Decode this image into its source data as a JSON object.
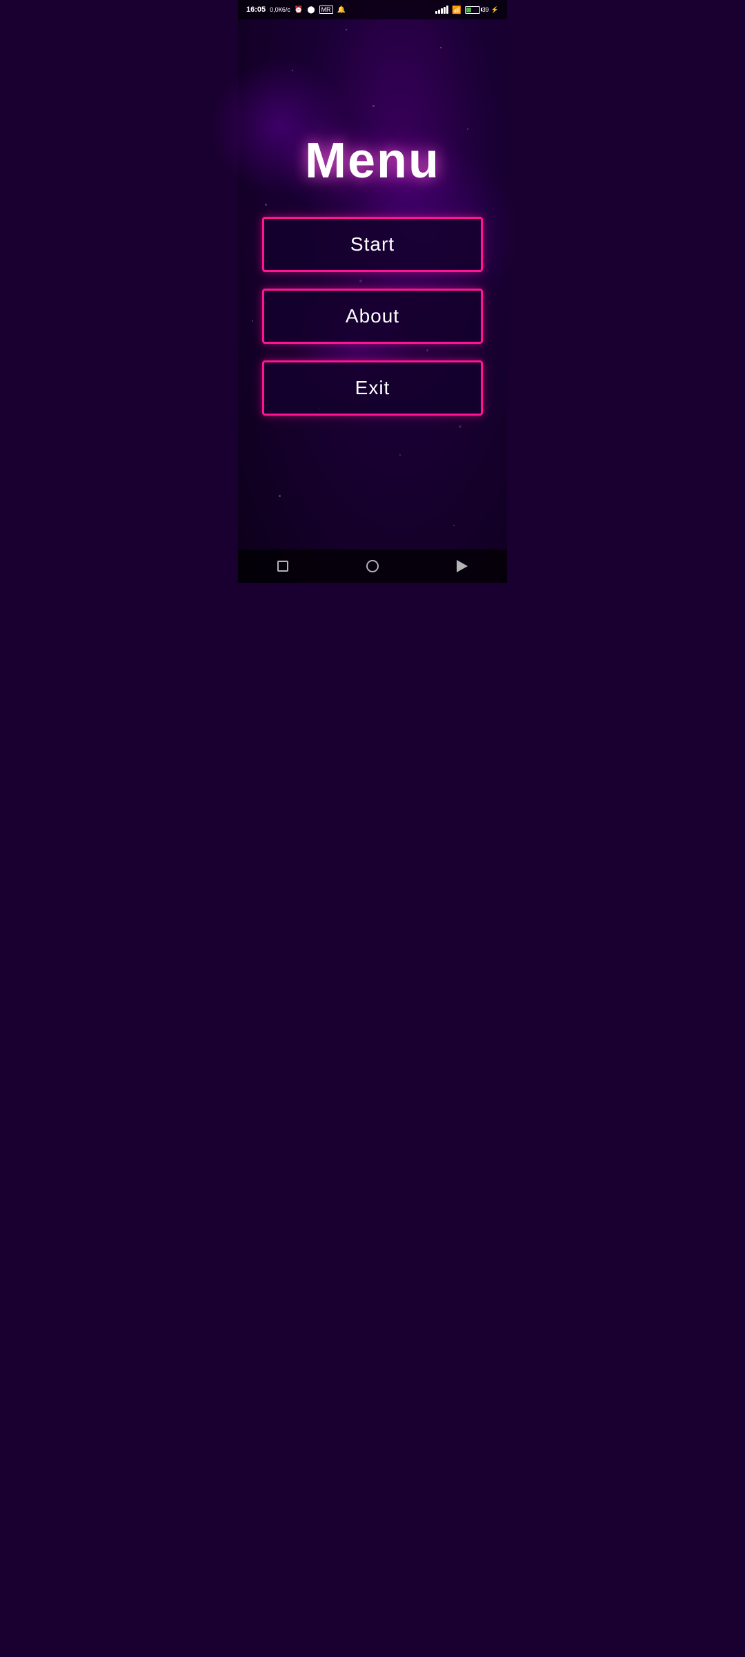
{
  "statusBar": {
    "time": "16:05",
    "dataSpeed": "0,0К6/с",
    "batteryPercent": "39"
  },
  "menu": {
    "title": "Menu",
    "buttons": [
      {
        "id": "start",
        "label": "Start"
      },
      {
        "id": "about",
        "label": "About"
      },
      {
        "id": "exit",
        "label": "Exit"
      }
    ]
  },
  "colors": {
    "background": "#1a0030",
    "buttonBorder": "#ff1493",
    "titleColor": "#ffffff",
    "buttonText": "#ffffff"
  },
  "navbar": {
    "items": [
      "square",
      "circle",
      "triangle"
    ]
  }
}
